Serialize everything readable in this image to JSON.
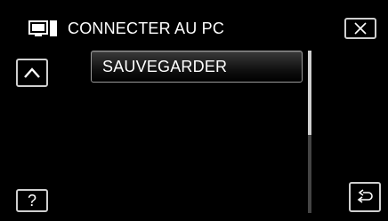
{
  "header": {
    "icon": "pc-monitor-icon",
    "title": "CONNECTER AU PC"
  },
  "controls": {
    "close_icon": "close-x-icon",
    "up_icon": "chevron-up-icon",
    "help_label": "?",
    "back_icon": "return-arrow-icon"
  },
  "menu": {
    "items": [
      {
        "label": "SAUVEGARDER"
      }
    ]
  },
  "scrollbar": {
    "position": 0,
    "visible_fraction": 0.52
  },
  "colors": {
    "background": "#000000",
    "text": "#ffffff",
    "button_border": "#cfcfcf"
  }
}
